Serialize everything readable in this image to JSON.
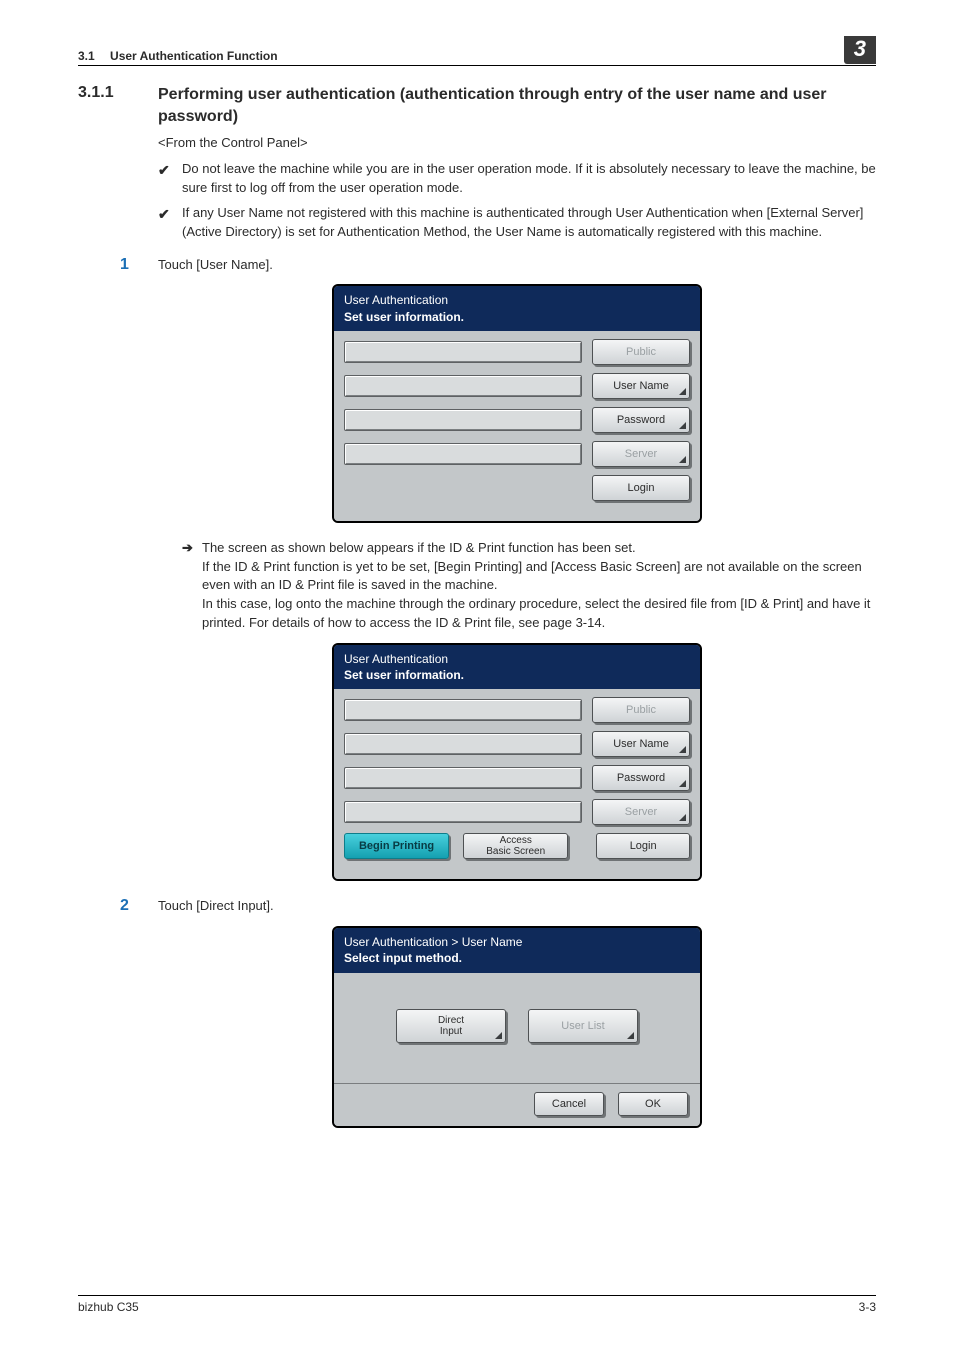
{
  "header": {
    "section_number": "3.1",
    "section_title": "User Authentication Function",
    "chapter_number": "3"
  },
  "section": {
    "number": "3.1.1",
    "title": "Performing user authentication (authentication through entry of the user name and user password)"
  },
  "subhead": "<From the Control Panel>",
  "checks": [
    "Do not leave the machine while you are in the user operation mode. If it is absolutely necessary to leave the machine, be sure first to log off from the user operation mode.",
    "If any User Name not registered with this machine is authenticated through User Authentication when [External Server] (Active Directory) is set for Authentication Method, the User Name is automatically registered with this machine."
  ],
  "step1": {
    "num": "1",
    "text": "Touch [User Name]."
  },
  "panel1": {
    "breadcrumb": "User Authentication",
    "prompt": "Set user information.",
    "buttons": {
      "public": "Public",
      "user_name": "User Name",
      "password": "Password",
      "server": "Server",
      "login": "Login"
    }
  },
  "arrow_block": [
    "The screen as shown below appears if the ID & Print function has been set.",
    "If the ID & Print function is yet to be set, [Begin Printing] and [Access Basic Screen] are not available on the screen even with an ID & Print file is saved in the machine.",
    "In this case, log onto the machine through the ordinary procedure, select the desired file from [ID & Print] and have it printed. For details of how to access the ID & Print file, see page 3-14."
  ],
  "panel2": {
    "breadcrumb": "User Authentication",
    "prompt": "Set user information.",
    "buttons": {
      "public": "Public",
      "user_name": "User Name",
      "password": "Password",
      "server": "Server",
      "login": "Login",
      "begin_printing": "Begin Printing",
      "access_basic_l1": "Access",
      "access_basic_l2": "Basic Screen"
    }
  },
  "step2": {
    "num": "2",
    "text": "Touch [Direct Input]."
  },
  "panel3": {
    "breadcrumb": "User Authentication > User Name",
    "prompt": "Select input method.",
    "buttons": {
      "direct_input_l1": "Direct",
      "direct_input_l2": "Input",
      "user_list": "User List",
      "cancel": "Cancel",
      "ok": "OK"
    }
  },
  "footer": {
    "product": "bizhub C35",
    "page": "3-3"
  }
}
